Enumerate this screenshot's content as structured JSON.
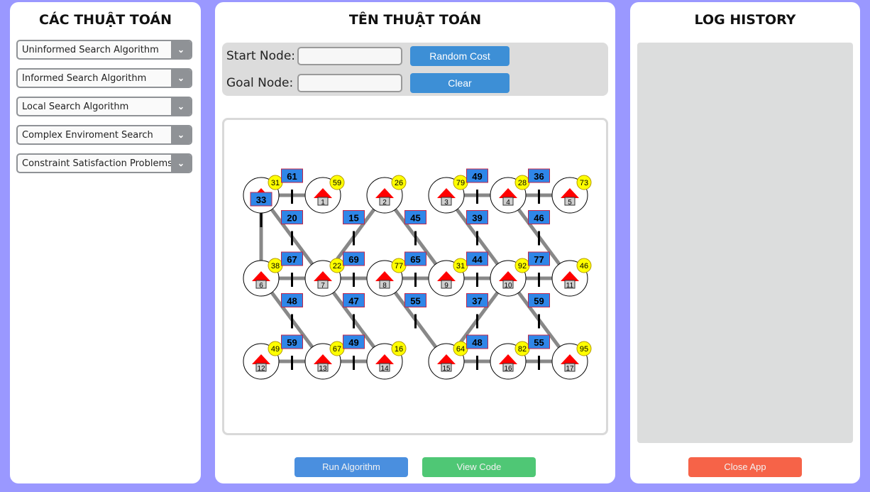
{
  "left_panel": {
    "title": "CÁC THUẬT TOÁN",
    "dropdowns": [
      "Uninformed Search Algorithm",
      "Informed Search Algorithm",
      "Local Search Algorithm",
      "Complex Enviroment Search",
      "Constraint Satisfaction Problems"
    ],
    "arrow_glyph": "⌄"
  },
  "middle_panel": {
    "title": "TÊN THUẬT TOÁN",
    "start_label": "Start Node:",
    "goal_label": "Goal Node:",
    "start_value": "",
    "goal_value": "",
    "random_cost_button": "Random Cost",
    "clear_button": "Clear",
    "run_button": "Run Algorithm",
    "view_code_button": "View Code"
  },
  "right_panel": {
    "title": "LOG HISTORY",
    "log_entries": [],
    "close_button": "Close App"
  },
  "colors": {
    "background": "#9a98ff",
    "blue_button": "#3d8fd6",
    "run_button": "#4a8fdf",
    "view_code_button": "#4fc775",
    "close_button": "#f66348",
    "edge": "#888888",
    "cost_box": "#2f86e8",
    "heuristic_badge": "#ffff00",
    "house_roof": "#ff0000"
  },
  "graph": {
    "nodes": [
      {
        "id": 0,
        "h": 31
      },
      {
        "id": 1,
        "h": 59
      },
      {
        "id": 2,
        "h": 26
      },
      {
        "id": 3,
        "h": 79
      },
      {
        "id": 4,
        "h": 28
      },
      {
        "id": 5,
        "h": 73
      },
      {
        "id": 6,
        "h": 38
      },
      {
        "id": 7,
        "h": 22
      },
      {
        "id": 8,
        "h": 77
      },
      {
        "id": 9,
        "h": 31
      },
      {
        "id": 10,
        "h": 92
      },
      {
        "id": 11,
        "h": 46
      },
      {
        "id": 12,
        "h": 49
      },
      {
        "id": 13,
        "h": 67
      },
      {
        "id": 14,
        "h": 16
      },
      {
        "id": 15,
        "h": 64
      },
      {
        "id": 16,
        "h": 82
      },
      {
        "id": 17,
        "h": 95
      }
    ],
    "edges": [
      {
        "from": 0,
        "to": 1,
        "cost": 61
      },
      {
        "from": 3,
        "to": 4,
        "cost": 49
      },
      {
        "from": 4,
        "to": 5,
        "cost": 36
      },
      {
        "from": 0,
        "to": 6,
        "cost": 33
      },
      {
        "from": 0,
        "to": 7,
        "cost": 20
      },
      {
        "from": 2,
        "to": 7,
        "cost": 15
      },
      {
        "from": 2,
        "to": 9,
        "cost": 45
      },
      {
        "from": 3,
        "to": 10,
        "cost": 39
      },
      {
        "from": 4,
        "to": 11,
        "cost": 46
      },
      {
        "from": 6,
        "to": 7,
        "cost": 67
      },
      {
        "from": 7,
        "to": 8,
        "cost": 69
      },
      {
        "from": 8,
        "to": 9,
        "cost": 65
      },
      {
        "from": 9,
        "to": 10,
        "cost": 44
      },
      {
        "from": 10,
        "to": 11,
        "cost": 77
      },
      {
        "from": 6,
        "to": 13,
        "cost": 48
      },
      {
        "from": 7,
        "to": 14,
        "cost": 47
      },
      {
        "from": 8,
        "to": 15,
        "cost": 55
      },
      {
        "from": 10,
        "to": 15,
        "cost": 37
      },
      {
        "from": 10,
        "to": 17,
        "cost": 59
      },
      {
        "from": 12,
        "to": 13,
        "cost": 59
      },
      {
        "from": 13,
        "to": 14,
        "cost": 49
      },
      {
        "from": 15,
        "to": 16,
        "cost": 48
      },
      {
        "from": 16,
        "to": 17,
        "cost": 55
      }
    ]
  }
}
